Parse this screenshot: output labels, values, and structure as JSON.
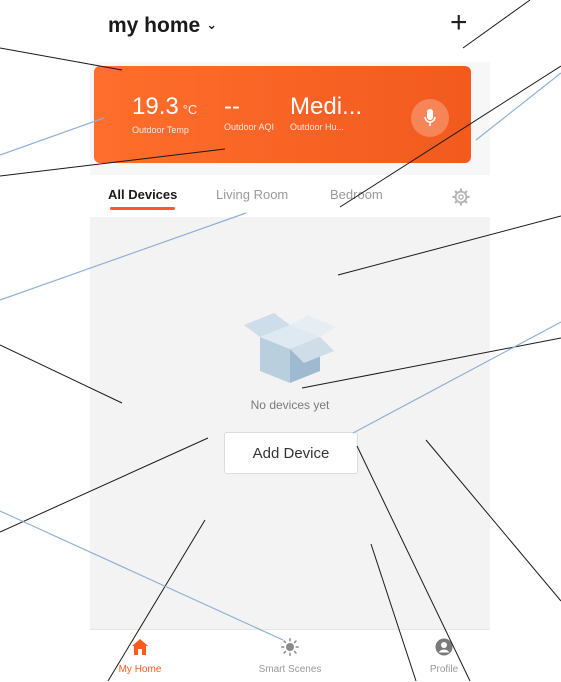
{
  "header": {
    "home_name": "my home",
    "chevron": "⌄",
    "add_icon": "+"
  },
  "weather": {
    "temp_value": "19.3",
    "temp_unit": "°C",
    "temp_label": "Outdoor Temp",
    "aqi_value": "--",
    "aqi_label": "Outdoor AQI",
    "humidity_value": "Medi...",
    "humidity_label": "Outdoor Hu...",
    "mic_icon": "microphone-icon"
  },
  "tabs": [
    {
      "label": "All Devices",
      "active": true
    },
    {
      "label": "Living Room",
      "active": false
    },
    {
      "label": "Bedroom",
      "active": false
    }
  ],
  "settings_icon": "gear-icon",
  "empty_state": {
    "icon": "empty-box-icon",
    "message": "No devices yet",
    "button_label": "Add Device"
  },
  "bottom_nav": [
    {
      "label": "My Home",
      "icon": "house-icon",
      "active": true
    },
    {
      "label": "Smart Scenes",
      "icon": "sun-icon",
      "active": false
    },
    {
      "label": "Profile",
      "icon": "person-icon",
      "active": false
    }
  ],
  "colors": {
    "accent": "#ff5a1f",
    "banner": "#f46423",
    "background": "#f3f3f3"
  }
}
